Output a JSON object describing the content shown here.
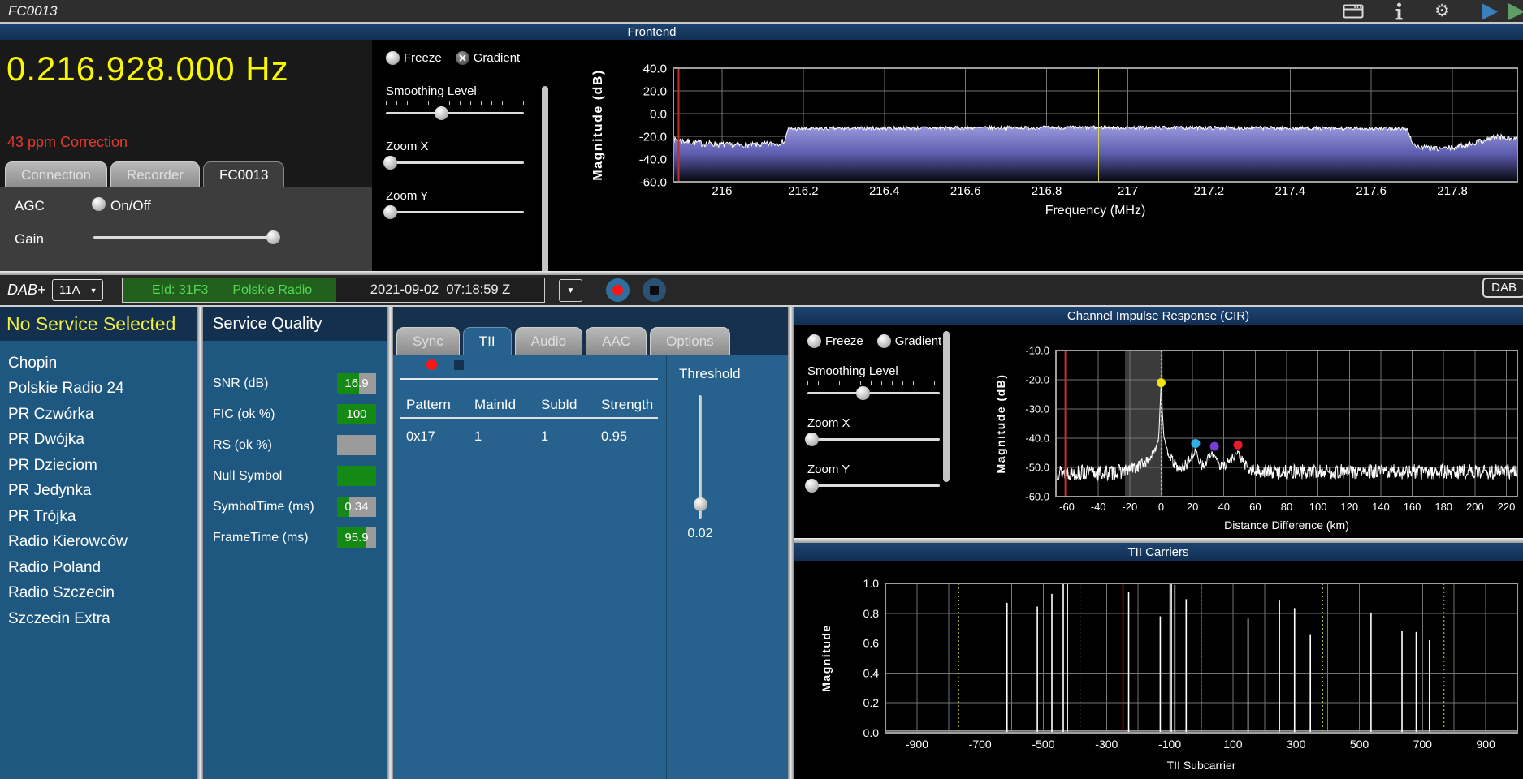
{
  "window": {
    "title": "FC0013"
  },
  "titlebar_icons": [
    "window-icon",
    "info-icon",
    "settings-gear-icon",
    "play-blue-icon",
    "play-green-icon"
  ],
  "frontend": {
    "frequency": "0.216.928.000",
    "frequency_unit": "Hz",
    "correction": "43 ppm Correction",
    "tabs": [
      {
        "label": "Connection",
        "active": false
      },
      {
        "label": "Recorder",
        "active": false
      },
      {
        "label": "FC0013",
        "active": true
      }
    ],
    "agc_label": "AGC",
    "agc_option": "On/Off",
    "agc_checked": false,
    "gain_label": "Gain",
    "gain_value_pct": 96,
    "controls": {
      "radios": [
        {
          "label": "Freeze",
          "checked": false
        },
        {
          "label": "Gradient",
          "checked": true
        }
      ],
      "sliders": [
        {
          "label": "Smoothing Level",
          "value_pct": 40,
          "ticks": true
        },
        {
          "label": "Zoom X",
          "value_pct": 3,
          "ticks": false
        },
        {
          "label": "Zoom Y",
          "value_pct": 3,
          "ticks": false
        }
      ]
    }
  },
  "dab_bar": {
    "mode_label": "DAB+",
    "channel": "11A",
    "ensemble_id": "EId: 31F3",
    "ensemble_name": "Polskie Radio",
    "timestamp": "2021-09-02  07:18:59 Z",
    "output_label": "DAB"
  },
  "service_list": {
    "header": "No Service Selected",
    "stations": [
      "Chopin",
      "Polskie Radio 24",
      "PR Czwórka",
      "PR Dwójka",
      "PR Dzieciom",
      "PR Jedynka",
      "PR Trójka",
      "Radio Kierowców",
      "Radio Poland",
      "Radio Szczecin",
      "Szczecin Extra"
    ]
  },
  "service_quality": {
    "header": "Service Quality",
    "rows": [
      {
        "label": "SNR (dB)",
        "value": "16.9",
        "fill_pct": 56
      },
      {
        "label": "FIC (ok %)",
        "value": "100",
        "fill_pct": 100
      },
      {
        "label": "RS (ok %)",
        "value": "",
        "fill_pct": 0
      },
      {
        "label": "Null Symbol",
        "value": "",
        "fill_pct": 100
      },
      {
        "label": "SymbolTime (ms)",
        "value": "0.34",
        "fill_pct": 32
      },
      {
        "label": "FrameTime (ms)",
        "value": "95.9",
        "fill_pct": 72
      }
    ]
  },
  "detail": {
    "tabs": [
      {
        "label": "Sync",
        "active": false
      },
      {
        "label": "TII",
        "active": true
      },
      {
        "label": "Audio",
        "active": false
      },
      {
        "label": "AAC",
        "active": false
      },
      {
        "label": "Options",
        "active": false
      }
    ],
    "tii_table": {
      "columns": [
        "Pattern",
        "MainId",
        "SubId",
        "Strength"
      ],
      "rows": [
        [
          "0x17",
          "1",
          "1",
          "0.95"
        ]
      ]
    },
    "threshold": {
      "label": "Threshold",
      "value": "0.02",
      "slider_pct": 93
    }
  },
  "cir": {
    "controls": {
      "radios": [
        {
          "label": "Freeze",
          "checked": false
        },
        {
          "label": "Gradient",
          "checked": false
        }
      ],
      "sliders": [
        {
          "label": "Smoothing Level",
          "value_pct": 42,
          "ticks": true
        },
        {
          "label": "Zoom X",
          "value_pct": 3,
          "ticks": false
        },
        {
          "label": "Zoom Y",
          "value_pct": 3,
          "ticks": false
        }
      ]
    }
  },
  "colors": {
    "frequency_yellow": "#f8f800",
    "correction_red": "#e23b2e",
    "panel_blue": "#1e5881",
    "detail_blue": "#27618d",
    "header_navy": "#14304f",
    "badge_green": "#148a14",
    "badge_gray": "#9b9b9b",
    "ensemble_green_bg": "#215f1d",
    "ensemble_green_text": "#55d855"
  },
  "chart_data": [
    {
      "id": "frontend-spectrum",
      "type": "area",
      "title": "Frontend",
      "xlabel": "Frequency (MHz)",
      "ylabel": "Magnitude (dB)",
      "xlim": [
        215.88,
        217.96
      ],
      "ylim": [
        -60,
        40
      ],
      "xticks": [
        216,
        216.2,
        216.4,
        216.6,
        216.8,
        217,
        217.2,
        217.4,
        217.6,
        217.8
      ],
      "xtick_labels": [
        "216",
        "216.2",
        "216.4",
        "216.6",
        "216.8",
        "217",
        "217.2",
        "217.4",
        "217.6",
        "217.8"
      ],
      "yticks": [
        40,
        20,
        0,
        -20,
        -40,
        -60
      ],
      "ytick_labels": [
        "40.0",
        "20.0",
        "0.0",
        "-20.0",
        "-40.0",
        "-60.0"
      ],
      "xgrid": [
        216,
        216.2,
        216.4,
        216.6,
        216.8,
        217,
        217.2,
        217.4,
        217.6,
        217.8
      ],
      "ygrid": [
        40,
        20,
        0,
        -20,
        -40,
        -60
      ],
      "grid": true,
      "envelope": [
        [
          215.88,
          -23,
          2.5
        ],
        [
          215.95,
          -26,
          3
        ],
        [
          216.03,
          -28,
          2.5
        ],
        [
          216.09,
          -27.5,
          2.5
        ],
        [
          216.14,
          -26,
          2.5
        ],
        [
          216.155,
          -24,
          2
        ],
        [
          216.162,
          -13.5,
          1.6
        ],
        [
          216.4,
          -12.8,
          1.6
        ],
        [
          216.9,
          -12.2,
          1.6
        ],
        [
          217.3,
          -12.6,
          1.6
        ],
        [
          217.6,
          -13.2,
          1.6
        ],
        [
          217.688,
          -13.5,
          1.6
        ],
        [
          217.7,
          -24,
          2
        ],
        [
          217.71,
          -29,
          2.2
        ],
        [
          217.76,
          -31,
          2.2
        ],
        [
          217.8,
          -30,
          2.5
        ],
        [
          217.84,
          -27,
          2.5
        ],
        [
          217.88,
          -23,
          2.5
        ],
        [
          217.91,
          -20,
          2.5
        ],
        [
          217.96,
          -23,
          2.5
        ]
      ],
      "points": 1100,
      "noise_seed": 7,
      "line_color": "#ffffff",
      "fill_gradient": [
        [
          0,
          "#9a9ade"
        ],
        [
          0.5,
          "#5d5db0"
        ],
        [
          1,
          "#05050e"
        ]
      ],
      "vlines": [
        {
          "x": 215.893,
          "color": "#c03028",
          "width": 2
        },
        {
          "x": 216.928,
          "color": "#d8d848",
          "width": 1
        }
      ]
    },
    {
      "id": "cir",
      "type": "line",
      "title": "Channel Impulse Response (CIR)",
      "xlabel": "Distance Difference (km)",
      "ylabel": "Magnitude (dB)",
      "xlim": [
        -67,
        227
      ],
      "ylim": [
        -60,
        -10
      ],
      "xticks": [
        -60,
        -40,
        -20,
        0,
        20,
        40,
        60,
        80,
        100,
        120,
        140,
        160,
        180,
        200,
        220
      ],
      "xtick_labels": [
        "-60",
        "-40",
        "-20",
        "0",
        "20",
        "40",
        "60",
        "80",
        "100",
        "120",
        "140",
        "160",
        "180",
        "200",
        "220"
      ],
      "yticks": [
        -10,
        -20,
        -30,
        -40,
        -50,
        -60
      ],
      "ytick_labels": [
        "-10.0",
        "-20.0",
        "-30.0",
        "-40.0",
        "-50.0",
        "-60.0"
      ],
      "xgrid": [
        -60,
        -40,
        -20,
        0,
        20,
        40,
        60,
        80,
        100,
        120,
        140,
        160,
        180,
        200,
        220
      ],
      "ygrid": [
        -10,
        -20,
        -30,
        -40,
        -50,
        -60
      ],
      "grid": true,
      "band": {
        "x0": -23,
        "x1": 1,
        "color": "rgba(130,130,130,0.45)"
      },
      "envelope": [
        [
          -67,
          -51.5,
          2.8
        ],
        [
          -40,
          -52,
          2.8
        ],
        [
          -26,
          -51.5,
          2.6
        ],
        [
          -16,
          -50,
          2.2
        ],
        [
          -9,
          -48,
          1.8
        ],
        [
          -4,
          -44.5,
          1.2
        ],
        [
          -1.6,
          -40,
          0.8
        ],
        [
          -0.7,
          -30,
          0.5
        ],
        [
          0,
          -21,
          0
        ],
        [
          0.7,
          -30,
          0.5
        ],
        [
          1.6,
          -38,
          0.8
        ],
        [
          3,
          -43.5,
          1
        ],
        [
          5,
          -45.5,
          1.3
        ],
        [
          8,
          -48.5,
          1.8
        ],
        [
          12,
          -51,
          2
        ],
        [
          16,
          -49,
          2
        ],
        [
          20,
          -46,
          1.6
        ],
        [
          22,
          -44.3,
          1
        ],
        [
          24,
          -47,
          1.8
        ],
        [
          27,
          -50,
          2
        ],
        [
          30,
          -47,
          1.8
        ],
        [
          33,
          -45.5,
          1.2
        ],
        [
          35,
          -46,
          1.5
        ],
        [
          38,
          -50,
          2
        ],
        [
          43,
          -48,
          1.8
        ],
        [
          47,
          -45.8,
          1.4
        ],
        [
          49,
          -45,
          1.2
        ],
        [
          52,
          -48,
          1.8
        ],
        [
          56,
          -51,
          2.2
        ],
        [
          70,
          -51.5,
          2.6
        ],
        [
          227,
          -51.5,
          2.6
        ]
      ],
      "points": 950,
      "noise_seed": 13,
      "line_color": "#ffffff",
      "vlines": [
        {
          "x": -61,
          "color": "#c03028",
          "width": 2
        },
        {
          "x": 0,
          "color": "#d8d848",
          "width": 1,
          "dash": "2,3"
        }
      ],
      "markers": [
        {
          "x": 0,
          "y": -21,
          "color": "#f2e20e"
        },
        {
          "x": 22,
          "y": -41.8,
          "color": "#2bb0e8"
        },
        {
          "x": 34,
          "y": -42.8,
          "color": "#7a3bd6"
        },
        {
          "x": 49,
          "y": -42.3,
          "color": "#e8192c"
        }
      ]
    },
    {
      "id": "tii-carriers",
      "type": "stem",
      "title": "TII Carriers",
      "xlabel": "TII Subcarrier",
      "ylabel": "Magnitude",
      "xlim": [
        -1000,
        1000
      ],
      "ylim": [
        0,
        1
      ],
      "xticks": [
        -900,
        -700,
        -500,
        -300,
        -100,
        100,
        300,
        500,
        700,
        900
      ],
      "xtick_labels": [
        "-900",
        "-700",
        "-500",
        "-300",
        "-100",
        "100",
        "300",
        "500",
        "700",
        "900"
      ],
      "yticks": [
        0,
        0.2,
        0.4,
        0.6,
        0.8,
        1
      ],
      "ytick_labels": [
        "0.0",
        "0.2",
        "0.4",
        "0.6",
        "0.8",
        "1.0"
      ],
      "xgrid": [
        -900,
        -800,
        -700,
        -600,
        -500,
        -400,
        -300,
        -200,
        -100,
        0,
        100,
        200,
        300,
        400,
        500,
        600,
        700,
        800,
        900
      ],
      "ygrid": [
        0.2,
        0.4,
        0.6,
        0.8,
        1
      ],
      "grid": true,
      "baseline": {
        "y": 0.012,
        "color": "#8f8f8f",
        "width": 2
      },
      "impulses": [
        [
          -615,
          0.87
        ],
        [
          -519,
          0.845
        ],
        [
          -473,
          0.93
        ],
        [
          -437,
          1.0
        ],
        [
          -424,
          1.0
        ],
        [
          -230,
          0.94
        ],
        [
          -130,
          0.78
        ],
        [
          -95,
          1.0
        ],
        [
          -84,
          0.99
        ],
        [
          -48,
          0.895
        ],
        [
          148,
          0.765
        ],
        [
          247,
          0.885
        ],
        [
          295,
          0.835
        ],
        [
          345,
          0.66
        ],
        [
          537,
          0.805
        ],
        [
          635,
          0.685
        ],
        [
          680,
          0.675
        ],
        [
          722,
          0.62
        ]
      ],
      "vlines": [
        {
          "x": -768,
          "color": "#cfcf30",
          "width": 1,
          "dash": "2,3"
        },
        {
          "x": -384,
          "color": "#cfcf30",
          "width": 1,
          "dash": "2,3"
        },
        {
          "x": 0,
          "color": "#cfcf30",
          "width": 1,
          "dash": "2,3"
        },
        {
          "x": 384,
          "color": "#cfcf30",
          "width": 1,
          "dash": "2,3"
        },
        {
          "x": 768,
          "color": "#cfcf30",
          "width": 1,
          "dash": "2,3"
        },
        {
          "x": -248,
          "color": "#d42020",
          "width": 1.5
        }
      ]
    }
  ]
}
